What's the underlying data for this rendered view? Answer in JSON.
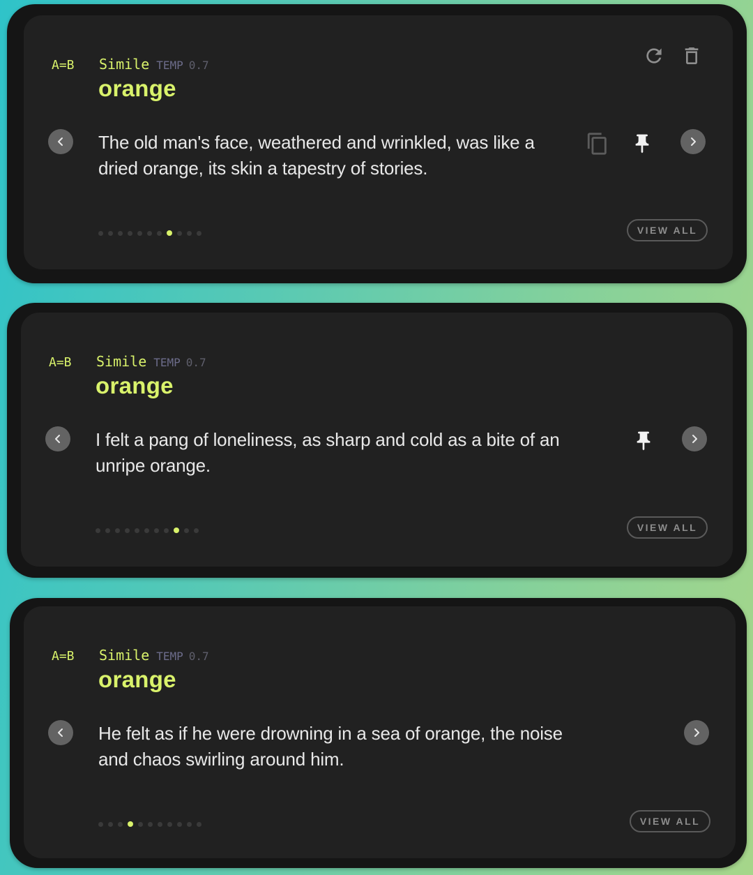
{
  "cards": [
    {
      "relation": "A=B",
      "type": "Simile",
      "temp_label": "TEMP",
      "temp_value": "0.7",
      "word": "orange",
      "sentence": "The old man's face, weathered and wrinkled, was like a dried orange, its skin a tapestry of stories.",
      "view_all": "VIEW ALL",
      "page_count": 11,
      "active_index": 7,
      "icons": [
        "refresh-icon",
        "trash-icon",
        "copy-icon",
        "pin-icon",
        "chevron-left-icon",
        "chevron-right-icon"
      ]
    },
    {
      "relation": "A=B",
      "type": "Simile",
      "temp_label": "TEMP",
      "temp_value": "0.7",
      "word": "orange",
      "sentence": "I felt a pang of loneliness, as sharp and cold as a bite of an unripe orange.",
      "view_all": "VIEW ALL",
      "page_count": 11,
      "active_index": 8,
      "icons": [
        "pin-icon",
        "chevron-left-icon",
        "chevron-right-icon"
      ]
    },
    {
      "relation": "A=B",
      "type": "Simile",
      "temp_label": "TEMP",
      "temp_value": "0.7",
      "word": "orange",
      "sentence": "He felt as if he were drowning in a sea of orange, the noise and chaos swirling around him.",
      "view_all": "VIEW ALL",
      "page_count": 11,
      "active_index": 3,
      "icons": [
        "chevron-left-icon",
        "chevron-right-icon"
      ]
    }
  ],
  "colors": {
    "accent": "#d9f26b",
    "card_bg": "#212121",
    "frame_bg": "#151515",
    "text": "#e8e8e8",
    "temp": "#6c6c8a"
  }
}
